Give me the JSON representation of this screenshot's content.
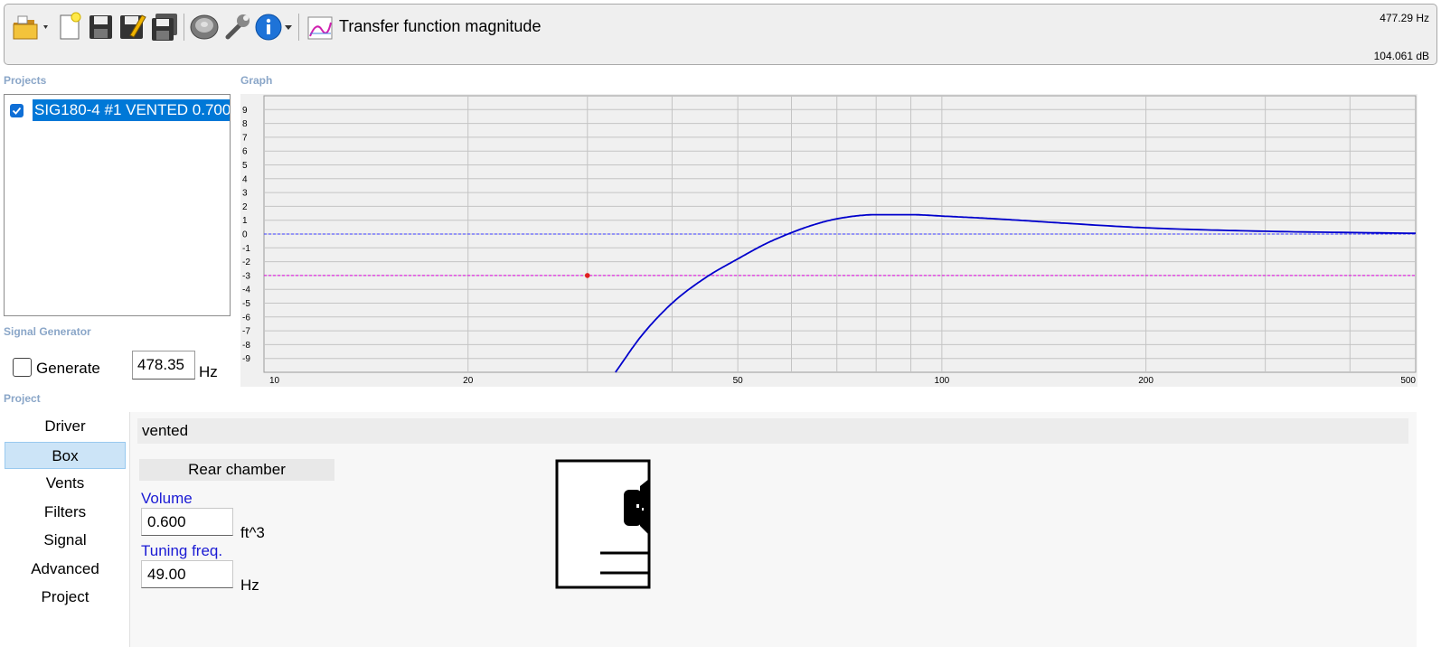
{
  "toolbar": {
    "title": "Transfer function magnitude",
    "readout_freq": "477.29 Hz",
    "readout_db": "104.061 dB",
    "icons": [
      "open-folder-icon",
      "new-document-icon",
      "save-icon",
      "save-as-icon",
      "save-all-icon",
      "speaker-icon",
      "tools-icon",
      "info-icon",
      "graph-icon"
    ]
  },
  "sections": {
    "projects": "Projects",
    "graph": "Graph",
    "signal_generator": "Signal Generator",
    "project": "Project"
  },
  "projects": {
    "items": [
      {
        "name": "SIG180-4 #1 VENTED 0.700",
        "checked": true
      }
    ]
  },
  "signal_generator": {
    "generate_label": "Generate",
    "checked": false,
    "frequency_value": "478.35",
    "unit": "Hz"
  },
  "chart_data": {
    "type": "line",
    "x_scale": "log",
    "xlim": [
      10,
      500
    ],
    "ylim": [
      -10,
      10
    ],
    "x_ticks": [
      10,
      20,
      50,
      100,
      200,
      500
    ],
    "y_ticks": [
      9,
      8,
      7,
      6,
      5,
      4,
      3,
      2,
      1,
      0,
      -1,
      -2,
      -3,
      -4,
      -5,
      -6,
      -7,
      -8,
      -9
    ],
    "grid": true,
    "reference_lines": [
      {
        "y": 0,
        "color": "#3a3aff",
        "style": "dashed"
      },
      {
        "y": -3,
        "color": "#e000e0",
        "style": "dashed"
      }
    ],
    "marker": {
      "x": 30,
      "y": -3,
      "color": "#e02020"
    },
    "series": [
      {
        "color": "#0000cc",
        "x": [
          33.0,
          36,
          40,
          45,
          50,
          55,
          60,
          65,
          70,
          80,
          90,
          100,
          120,
          150,
          200,
          300,
          500
        ],
        "y": [
          -10.0,
          -7.4,
          -5.0,
          -3.1,
          -1.8,
          -0.7,
          0.1,
          0.7,
          1.1,
          1.4,
          1.4,
          1.3,
          1.1,
          0.8,
          0.45,
          0.2,
          0.05
        ]
      }
    ]
  },
  "project_panel": {
    "nav": [
      {
        "label": "Driver",
        "active": false
      },
      {
        "label": "Box",
        "active": true
      },
      {
        "label": "Vents",
        "active": false
      },
      {
        "label": "Filters",
        "active": false
      },
      {
        "label": "Signal",
        "active": false
      },
      {
        "label": "Advanced",
        "active": false
      },
      {
        "label": "Project",
        "active": false
      }
    ],
    "box_type": "vented",
    "rear_chamber": {
      "header": "Rear chamber",
      "volume_label": "Volume",
      "volume_value": "0.600",
      "volume_unit": "ft^3",
      "tuning_label": "Tuning freq.",
      "tuning_value": "49.00",
      "tuning_unit": "Hz"
    }
  }
}
